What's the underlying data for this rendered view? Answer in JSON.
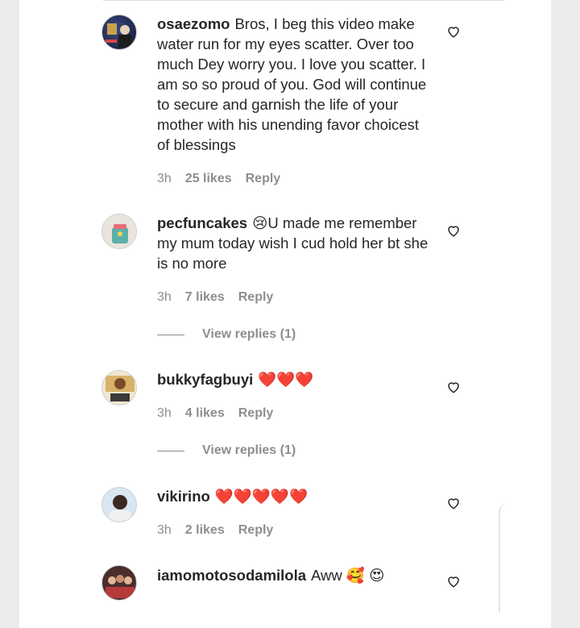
{
  "comments": [
    {
      "username": "osaezomo",
      "text": "Bros, I beg this video make water run for my eyes scatter. Over too much Dey worry you. I love you scatter. I am so so proud of you. God will continue to secure and garnish the life of your mother with his unending favor choicest of blessings",
      "time": "3h",
      "likes": "25 likes",
      "reply": "Reply",
      "view_replies": ""
    },
    {
      "username": "pecfuncakes",
      "text": "😢U made me remember my mum today wish I cud hold her bt she is no more",
      "time": "3h",
      "likes": "7 likes",
      "reply": "Reply",
      "view_replies": "View replies (1)"
    },
    {
      "username": "bukkyfagbuyi",
      "text": "❤️❤️❤️",
      "time": "3h",
      "likes": "4 likes",
      "reply": "Reply",
      "view_replies": "View replies (1)"
    },
    {
      "username": "vikirino",
      "text": "❤️❤️❤️❤️❤️",
      "time": "3h",
      "likes": "2 likes",
      "reply": "Reply",
      "view_replies": ""
    },
    {
      "username": "iamomotosodamilola",
      "text": "Aww 🥰 😍",
      "time": "",
      "likes": "",
      "reply": "",
      "view_replies": ""
    }
  ],
  "icons": {
    "like": "heart-outline-icon"
  },
  "colors": {
    "text": "#262626",
    "secondary": "#8e8e8e"
  }
}
